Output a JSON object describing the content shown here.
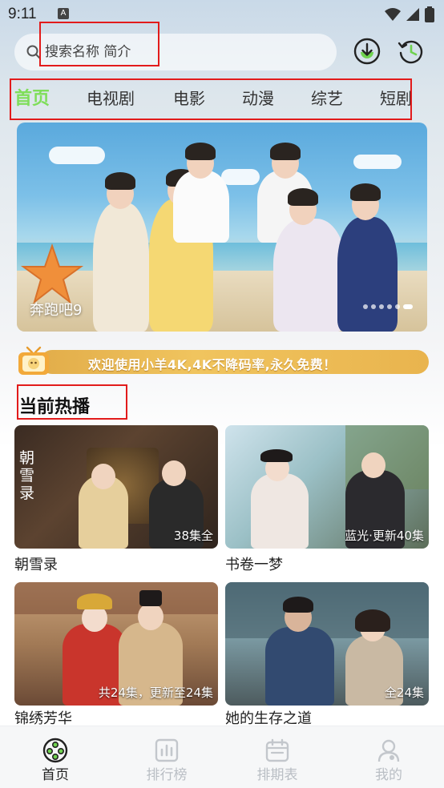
{
  "status_bar": {
    "time": "9:11",
    "notif_icon_letter": "A"
  },
  "search": {
    "placeholder": "搜索名称 简介"
  },
  "header_icons": [
    "download-icon",
    "history-icon"
  ],
  "tabs": [
    {
      "label": "首页",
      "active": true
    },
    {
      "label": "电视剧"
    },
    {
      "label": "电影"
    },
    {
      "label": "动漫"
    },
    {
      "label": "综艺"
    },
    {
      "label": "短剧"
    }
  ],
  "banner": {
    "title": "奔跑吧9",
    "slide_count": 6,
    "current_slide": 6
  },
  "notice": {
    "text": "欢迎使用小羊4K,4K不降码率,永久免费！"
  },
  "section": {
    "title": "当前热播"
  },
  "cards": [
    {
      "title": "朝雪录",
      "badge": "38集全",
      "poster_text": "朝雪录"
    },
    {
      "title": "书卷一梦",
      "badge": "蓝光·更新40集"
    },
    {
      "title": "锦绣芳华",
      "badge": "共24集，更新至24集"
    },
    {
      "title": "她的生存之道",
      "badge": "全24集"
    }
  ],
  "bottom_nav": [
    {
      "label": "首页",
      "icon": "film-reel-icon",
      "active": true
    },
    {
      "label": "排行榜",
      "icon": "chart-icon"
    },
    {
      "label": "排期表",
      "icon": "calendar-icon"
    },
    {
      "label": "我的",
      "icon": "profile-icon"
    }
  ],
  "colors": {
    "accent": "#7fde5a",
    "annotation": "#e21b1b",
    "notice": "#e9b44e"
  }
}
